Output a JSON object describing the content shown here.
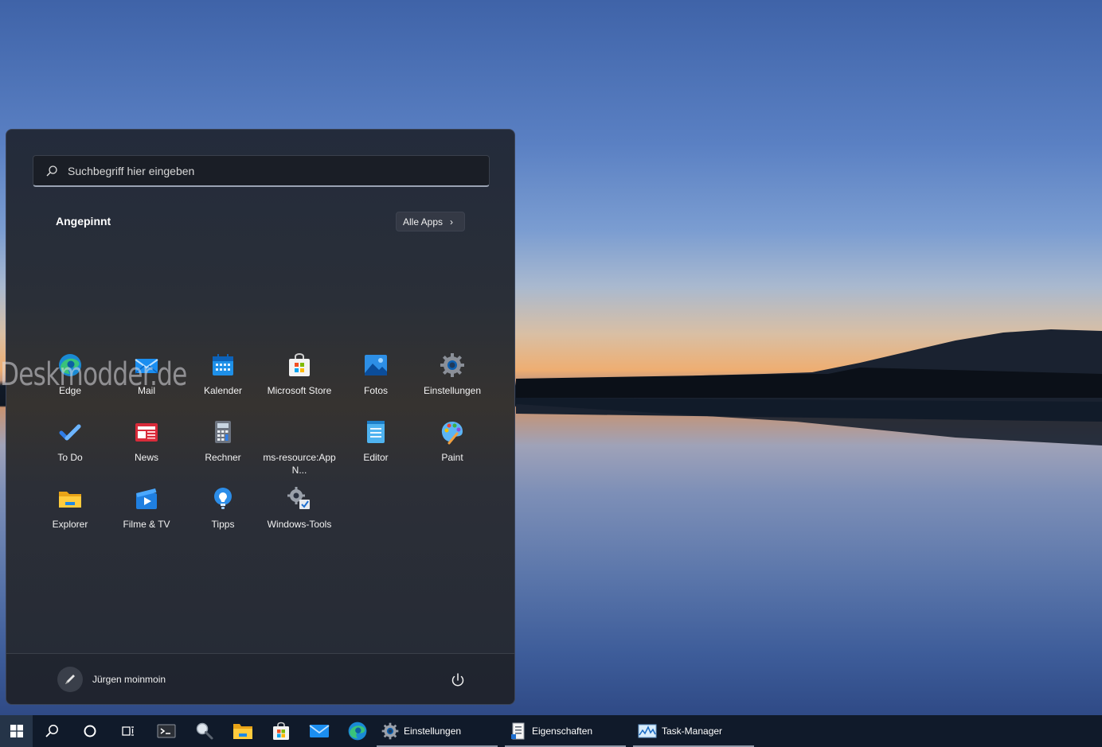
{
  "search": {
    "placeholder": "Suchbegriff hier eingeben"
  },
  "pinned": {
    "title": "Angepinnt",
    "all_apps_label": "Alle Apps",
    "apps": [
      {
        "label": "Edge",
        "icon": "edge-icon"
      },
      {
        "label": "Mail",
        "icon": "mail-icon"
      },
      {
        "label": "Kalender",
        "icon": "calendar-icon"
      },
      {
        "label": "Microsoft Store",
        "icon": "store-icon"
      },
      {
        "label": "Fotos",
        "icon": "photos-icon"
      },
      {
        "label": "Einstellungen",
        "icon": "settings-gear-icon"
      },
      {
        "label": "To Do",
        "icon": "todo-check-icon"
      },
      {
        "label": "News",
        "icon": "news-icon"
      },
      {
        "label": "Rechner",
        "icon": "calculator-icon"
      },
      {
        "label": "ms-resource:AppN...",
        "icon": "blank-app-icon"
      },
      {
        "label": "Editor",
        "icon": "notepad-icon"
      },
      {
        "label": "Paint",
        "icon": "paint-palette-icon"
      },
      {
        "label": "Explorer",
        "icon": "folder-icon"
      },
      {
        "label": "Filme & TV",
        "icon": "movies-tv-icon"
      },
      {
        "label": "Tipps",
        "icon": "tips-bulb-icon"
      },
      {
        "label": "Windows-Tools",
        "icon": "windows-tools-icon"
      }
    ]
  },
  "watermark": "Deskmodder.de",
  "user": {
    "name": "Jürgen moinmoin",
    "avatar_icon": "pen-avatar-icon"
  },
  "power_icon": "power-icon",
  "taskbar": {
    "open_apps": [
      {
        "label": "Einstellungen",
        "icon": "settings-gear-icon"
      },
      {
        "label": "Eigenschaften",
        "icon": "properties-icon"
      },
      {
        "label": "Task-Manager",
        "icon": "task-manager-icon"
      }
    ]
  },
  "colors": {
    "accent": "#0078d4",
    "taskbar_bg": "#101a2a",
    "menu_bg": "#242a36"
  }
}
